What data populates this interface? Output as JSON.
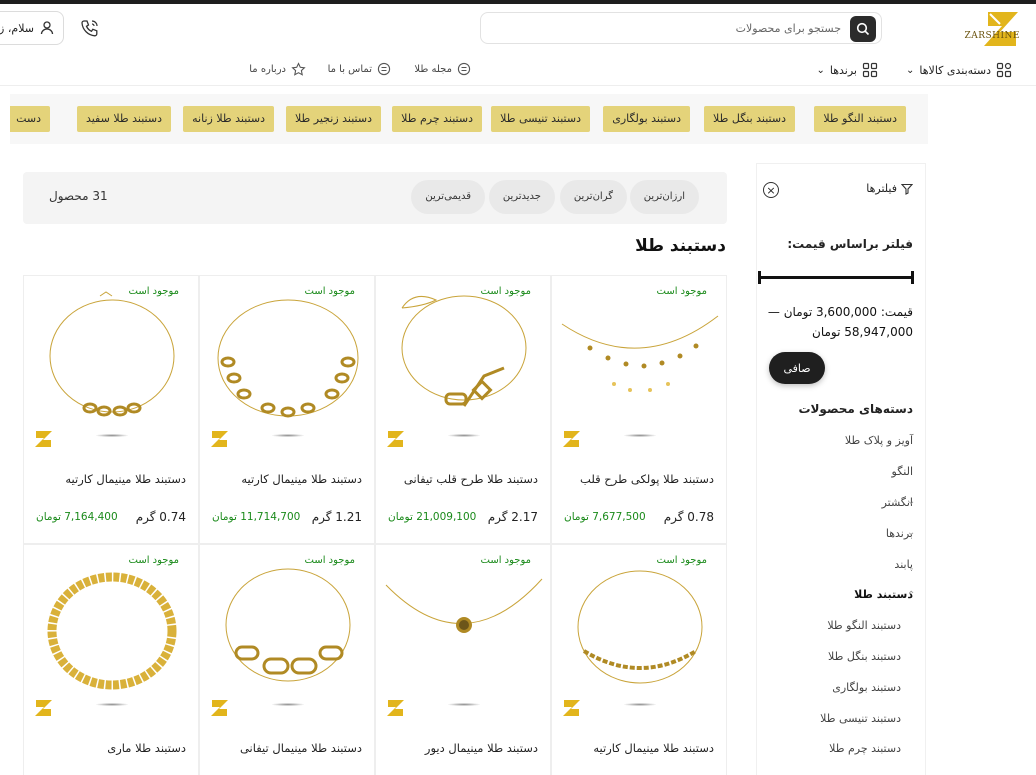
{
  "header": {
    "logo_text": "ZARSHINE",
    "search_placeholder": "جستجو برای محصولات",
    "account_label": "سلام، ز"
  },
  "nav": {
    "categories": "دسته‌بندی کالاها",
    "brands": "برندها",
    "magazine": "مجله طلا",
    "contact": "تماس با ما",
    "about": "درباره ما"
  },
  "chips": [
    "دستبند النگو طلا",
    "دستبند بنگل طلا",
    "دستبند بولگاری",
    "دستبند تنیسی طلا",
    "دستبند چرم طلا",
    "دستبند زنجیر طلا",
    "دستبند طلا زنانه",
    "دستبند طلا سفید",
    "دست"
  ],
  "sidebar": {
    "filters_label": "فیلترها",
    "price_filter_title": "فیلتر براساس قیمت:",
    "price_text": "قیمت: 3,600,000 تومان — 58,947,000 تومان",
    "apply_label": "صافی",
    "categories_title": "دسته‌های محصولات",
    "categories": [
      {
        "label": "آویز و پلاک طلا",
        "chevron": ""
      },
      {
        "label": "النگو",
        "chevron": ""
      },
      {
        "label": "انگشتر",
        "chevron": "⌄"
      },
      {
        "label": "برندها",
        "chevron": "⌄"
      },
      {
        "label": "پابند",
        "chevron": ""
      },
      {
        "label": "دستبند طلا",
        "chevron": "⌃"
      }
    ],
    "subcategories": [
      "دستبند النگو طلا",
      "دستبند بنگل طلا",
      "دستبند بولگاری",
      "دستبند تنیسی طلا",
      "دستبند چرم طلا"
    ]
  },
  "sort": {
    "options": [
      "ارزان‌ترین",
      "گران‌ترین",
      "جدیدترین",
      "قدیمی‌ترین"
    ],
    "count": "31 محصول"
  },
  "page_title": "دستبند طلا",
  "products": [
    {
      "stock": "موجود است",
      "name": "دستبند طلا پولکی طرح قلب",
      "weight": "0.78 گرم",
      "price": "7,677,500 تومان"
    },
    {
      "stock": "موجود است",
      "name": "دستبند طلا طرح قلب تیفانی",
      "weight": "2.17 گرم",
      "price": "21,009,100 تومان"
    },
    {
      "stock": "موجود است",
      "name": "دستبند طلا مینیمال کارتیه",
      "weight": "1.21 گرم",
      "price": "11,714,700 تومان"
    },
    {
      "stock": "موجود است",
      "name": "دستبند طلا مینیمال کارتیه",
      "weight": "0.74 گرم",
      "price": "7,164,400 تومان"
    },
    {
      "stock": "موجود است",
      "name": "دستبند طلا مینیمال کارتیه",
      "weight": "",
      "price": ""
    },
    {
      "stock": "موجود است",
      "name": "دستبند طلا مینیمال دیور",
      "weight": "",
      "price": ""
    },
    {
      "stock": "موجود است",
      "name": "دستبند طلا مینیمال تیفانی",
      "weight": "",
      "price": ""
    },
    {
      "stock": "موجود است",
      "name": "دستبند طلا ماری",
      "weight": "",
      "price": ""
    }
  ],
  "colors": {
    "accent": "#e4d37a",
    "in_stock": "#1a8a1a",
    "dark": "#1f1f1f"
  }
}
